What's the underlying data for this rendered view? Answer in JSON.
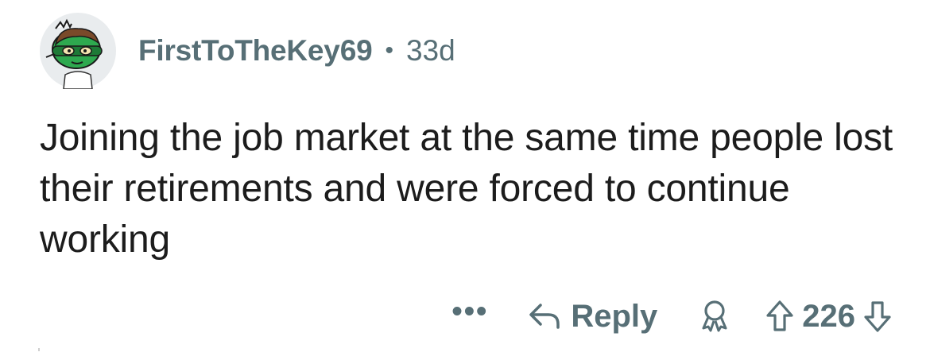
{
  "comment": {
    "author": "FirstToTheKey69",
    "separator": "•",
    "age": "33d",
    "text": "Joining the job market at the same time people lost their retirements and were forced to continue working",
    "avatar_icon": "snoo-avatar-icon"
  },
  "actions": {
    "more_label": "•••",
    "reply_label": "Reply",
    "score": "226",
    "reply_icon": "reply-arrow-icon",
    "award_icon": "award-icon",
    "upvote_icon": "upvote-arrow-icon",
    "downvote_icon": "downvote-arrow-icon"
  },
  "colors": {
    "meta_text": "#576f76",
    "body_text": "#1c1c1c",
    "avatar_bg": "#e9ecee",
    "avatar_green": "#2ea94f"
  }
}
